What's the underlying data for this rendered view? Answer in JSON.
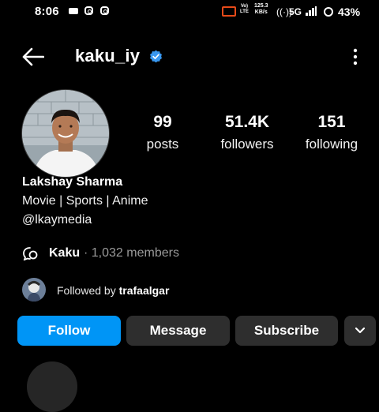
{
  "status_bar": {
    "time": "8:06",
    "volte_line1": "Vo)",
    "volte_line2": "LTE",
    "speed_value": "125.3",
    "speed_unit": "KB/s",
    "network": "5G",
    "battery": "43%"
  },
  "header": {
    "username": "kaku_iy",
    "verified_color": "#3897f0"
  },
  "stats": {
    "posts_count": "99",
    "posts_label": "posts",
    "followers_count": "51.4K",
    "followers_label": "followers",
    "following_count": "151",
    "following_label": "following"
  },
  "bio": {
    "name": "Lakshay Sharma",
    "line": "Movie | Sports | Anime",
    "link": "@lkaymedia"
  },
  "channel": {
    "name": "Kaku",
    "members": "· 1,032 members"
  },
  "followed_by": {
    "prefix": "Followed by ",
    "user": "trafaalgar"
  },
  "buttons": {
    "follow": "Follow",
    "message": "Message",
    "subscribe": "Subscribe"
  },
  "colors": {
    "accent": "#0095f6",
    "button_bg": "#2e2e2e",
    "background": "#000000"
  }
}
